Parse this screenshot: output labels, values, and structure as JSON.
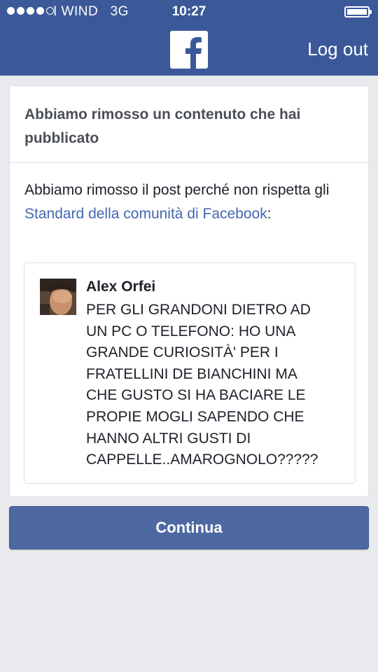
{
  "status_bar": {
    "carrier": "I WIND",
    "network": "3G",
    "time": "10:27",
    "signal_dots_filled": 4,
    "signal_dots_total": 5
  },
  "header": {
    "logo_icon": "facebook-f-icon",
    "logout_label": "Log out",
    "brand_color": "#3b5998"
  },
  "notice": {
    "title": "Abbiamo rimosso un contenuto che hai pubblicato",
    "body_prefix": "Abbiamo rimosso il post perché non rispetta gli ",
    "body_link": "Standard della comunità di Facebook",
    "body_suffix": ":"
  },
  "post": {
    "author": "Alex Orfei",
    "text": "PER GLI GRANDONI DIETRO AD\nUN PC O TELEFONO: HO UNA\nGRANDE CURIOSITÀ' PER I\nFRATELLINI DE BIANCHINI MA\nCHE GUSTO SI HA BACIARE LE\nPROPIE MOGLI SAPENDO CHE\nHANNO ALTRI GUSTI DI\nCAPPELLE..AMAROGNOLO?????"
  },
  "actions": {
    "continue_label": "Continua"
  }
}
